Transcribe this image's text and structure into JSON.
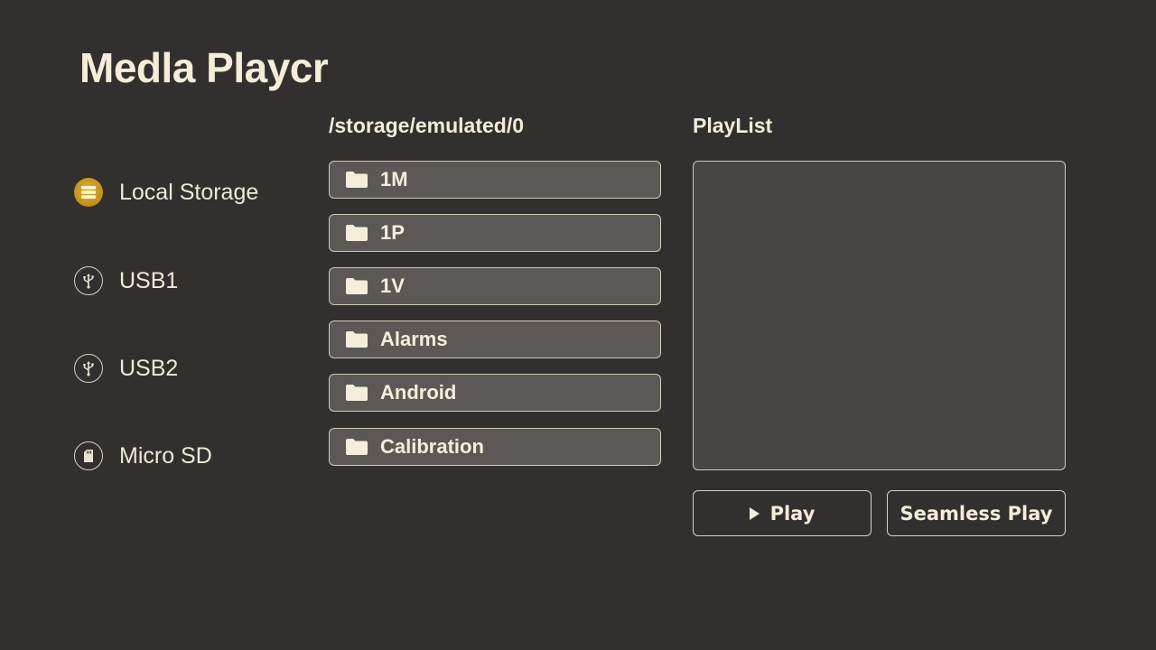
{
  "app": {
    "title": "Medla Playcr"
  },
  "sidebar": {
    "items": [
      {
        "label": "Local Storage",
        "icon": "storage-icon",
        "active": true
      },
      {
        "label": "USB1",
        "icon": "usb-icon",
        "active": false
      },
      {
        "label": "USB2",
        "icon": "usb-icon",
        "active": false
      },
      {
        "label": "Micro SD",
        "icon": "sd-card-icon",
        "active": false
      }
    ]
  },
  "browser": {
    "path": "/storage/emulated/0",
    "items": [
      {
        "name": "1M",
        "icon": "folder-icon"
      },
      {
        "name": "1P",
        "icon": "folder-icon"
      },
      {
        "name": "1V",
        "icon": "folder-icon"
      },
      {
        "name": "Alarms",
        "icon": "folder-icon"
      },
      {
        "name": "Android",
        "icon": "folder-icon"
      },
      {
        "name": "Calibration",
        "icon": "folder-icon"
      }
    ]
  },
  "playlist": {
    "title": "PlayList",
    "items": []
  },
  "controls": {
    "play_label": "Play",
    "seamless_label": "Seamless Play"
  },
  "colors": {
    "background": "#32302e",
    "accent": "#c99b22",
    "item_fill": "#5c5855",
    "text": "#f2ecdb"
  }
}
